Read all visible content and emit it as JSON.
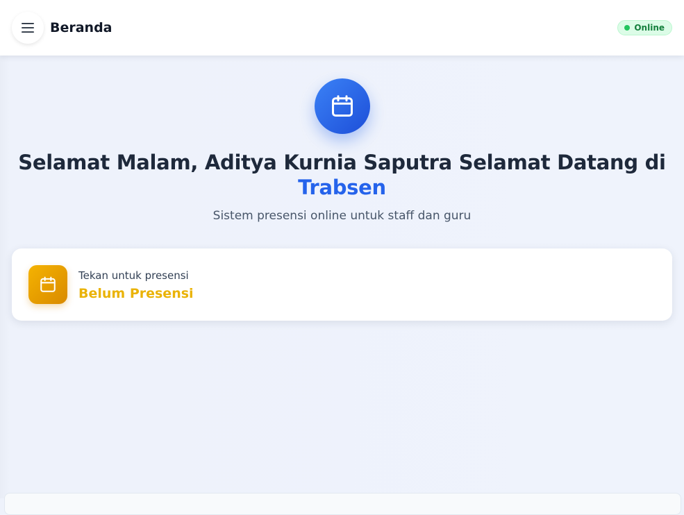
{
  "header": {
    "title": "Beranda",
    "menu_icon": "hamburger-menu-icon",
    "status_label": "Online",
    "status_color": "#22c55e"
  },
  "hero": {
    "icon": "calendar-icon",
    "greeting": "Selamat Malam, Aditya Kurnia Saputra Selamat Datang di",
    "brand": "Trabsen",
    "subtitle": "Sistem presensi online untuk staff dan guru",
    "accent_color": "#2563eb"
  },
  "attendance_card": {
    "icon": "calendar-icon",
    "hint": "Tekan untuk presensi",
    "status": "Belum Presensi",
    "status_color": "#eab308"
  }
}
